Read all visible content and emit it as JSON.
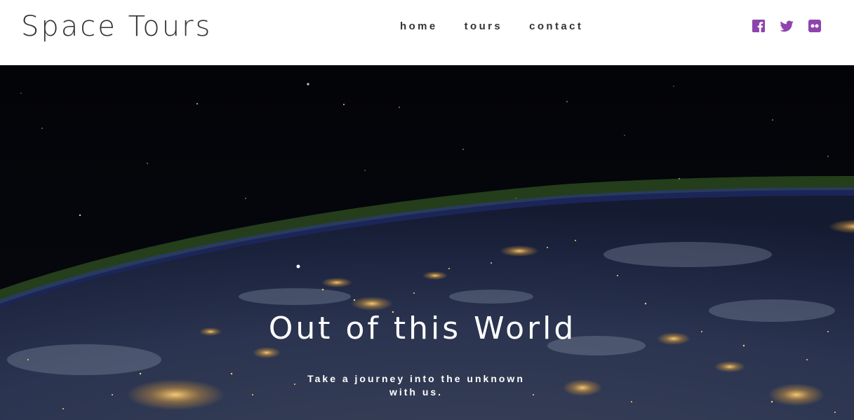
{
  "site": {
    "brand": "Space Tours",
    "accent_color": "#8e44ad"
  },
  "nav": {
    "items": [
      {
        "label": "home"
      },
      {
        "label": "tours"
      },
      {
        "label": "contact"
      }
    ]
  },
  "social": {
    "icons": [
      "facebook-icon",
      "twitter-icon",
      "flickr-icon"
    ]
  },
  "hero": {
    "title": "Out of this World",
    "subtitle": "Take a journey into the unknown with us."
  }
}
